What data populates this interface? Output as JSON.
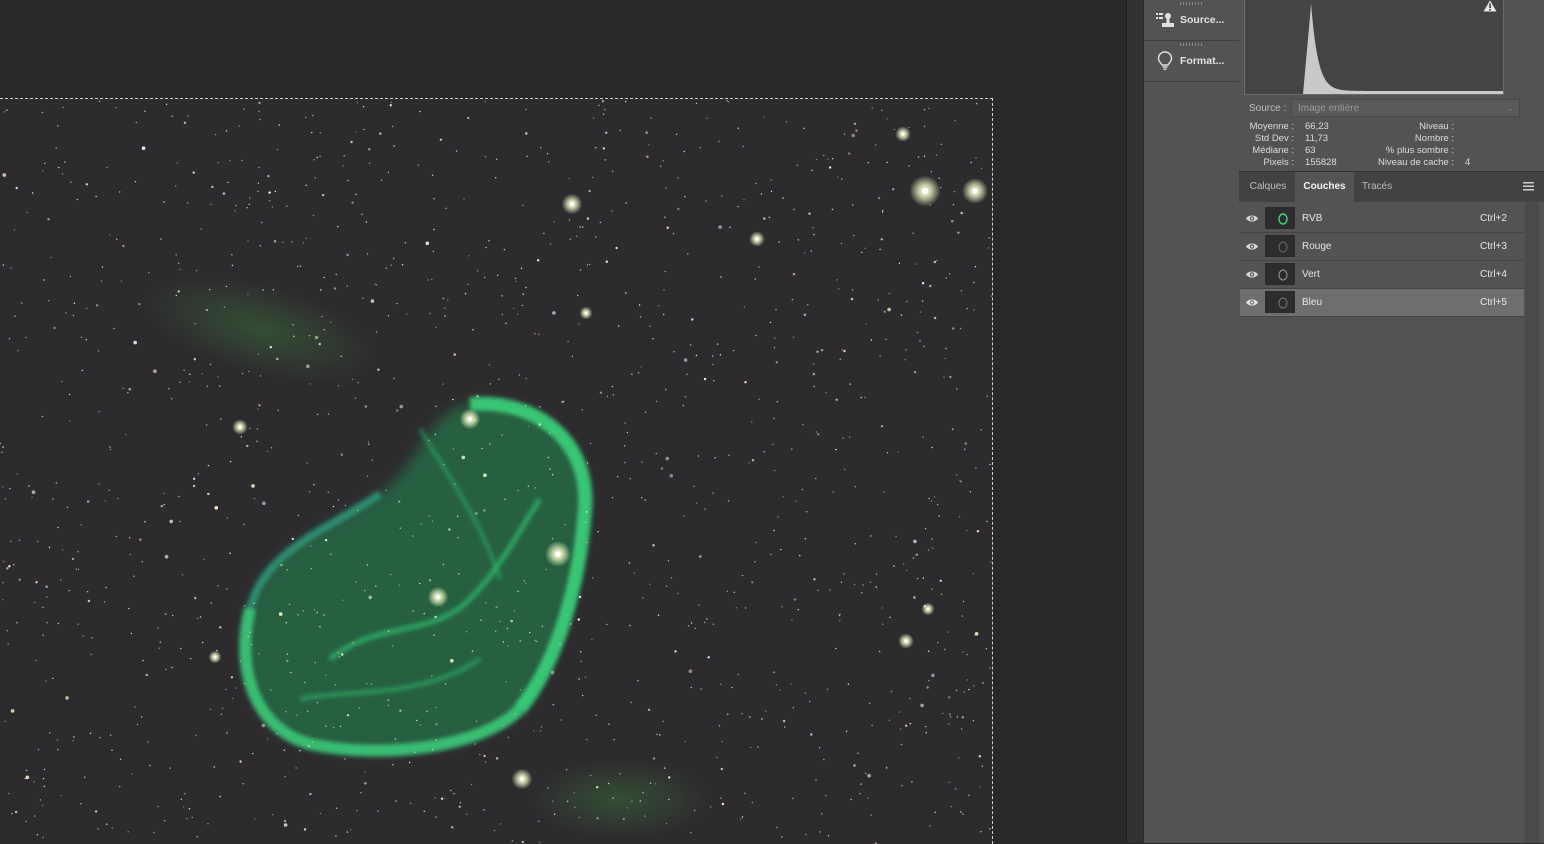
{
  "canvas": {
    "image_description_alt": "",
    "bg_color": "#2e2b2f",
    "nebula_color": "#2fd870"
  },
  "panel_strip": {
    "items": [
      {
        "label": "Source...",
        "icon": "clone-source-icon"
      },
      {
        "label": "Format...",
        "icon": "lightbulb-icon"
      }
    ]
  },
  "histogram": {
    "source_label": "Source :",
    "source_value": "Image entière",
    "stats_left": [
      {
        "label": "Moyenne :",
        "value": "66,23"
      },
      {
        "label": "Std Dev :",
        "value": "11,73"
      },
      {
        "label": "Médiane :",
        "value": "63"
      },
      {
        "label": "Pixels :",
        "value": "155828"
      }
    ],
    "stats_right": [
      {
        "label": "Niveau :",
        "value": ""
      },
      {
        "label": "Nombre :",
        "value": ""
      },
      {
        "label": "% plus sombre :",
        "value": ""
      },
      {
        "label": "Niveau de cache :",
        "value": "4"
      }
    ]
  },
  "tabs": [
    {
      "label": "Calques",
      "active": false
    },
    {
      "label": "Couches",
      "active": true
    },
    {
      "label": "Tracés",
      "active": false
    }
  ],
  "channels": [
    {
      "name": "RVB",
      "shortcut": "Ctrl+2",
      "selected": false
    },
    {
      "name": "Rouge",
      "shortcut": "Ctrl+3",
      "selected": false
    },
    {
      "name": "Vert",
      "shortcut": "Ctrl+4",
      "selected": false
    },
    {
      "name": "Bleu",
      "shortcut": "Ctrl+5",
      "selected": true
    }
  ],
  "colors": {
    "ui_bg": "#535353",
    "workspace": "#282828",
    "selected_row": "#6e6e6e"
  }
}
